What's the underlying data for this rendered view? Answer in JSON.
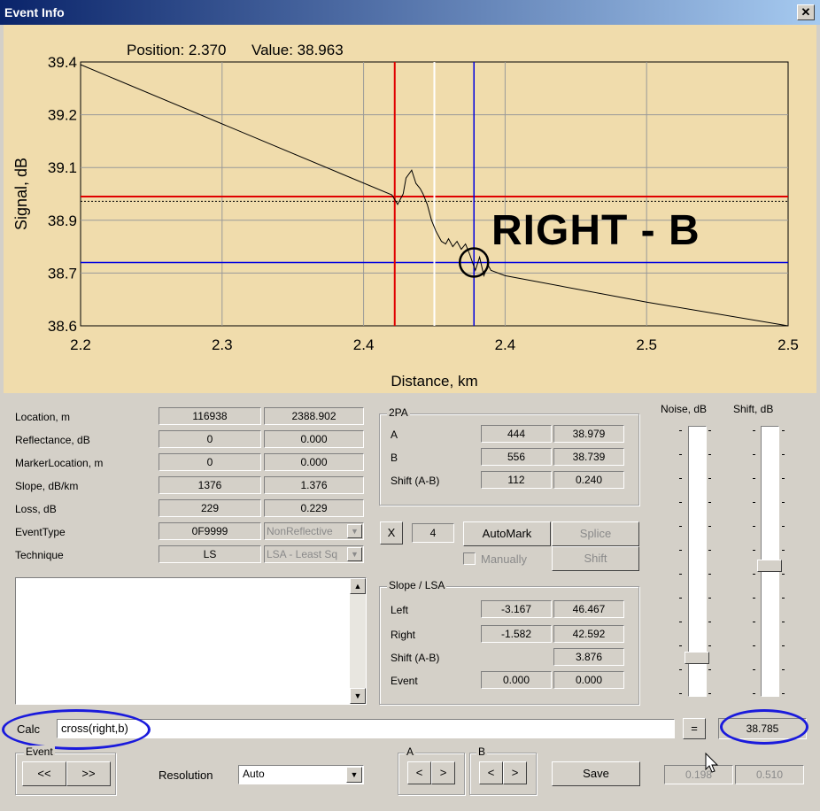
{
  "window": {
    "title": "Event Info",
    "close_glyph": "✕"
  },
  "plot": {
    "position_label": "Position: 2.370",
    "value_label": "Value: 38.963",
    "annotation": "RIGHT - B",
    "colors": {
      "red": "#e00000",
      "blue": "#0000e0",
      "white": "#ffffff",
      "trace": "#000000"
    }
  },
  "chart_data": {
    "type": "line",
    "xlabel": "Distance, km",
    "ylabel": "Signal, dB",
    "x_ticks": [
      "2.2",
      "2.3",
      "2.4",
      "2.4",
      "2.5",
      "2.5"
    ],
    "y_ticks": [
      "39.4",
      "39.2",
      "39.1",
      "38.9",
      "38.7",
      "38.6"
    ],
    "xlim": [
      0,
      5
    ],
    "ylim": [
      0,
      5
    ],
    "trace_x": [
      0,
      2.2,
      2.24,
      2.28,
      2.3,
      2.34,
      2.37,
      2.4,
      2.42,
      2.45,
      2.48,
      2.51,
      2.55,
      2.58,
      2.6,
      2.63,
      2.66,
      2.69,
      2.72,
      2.75,
      2.77,
      2.79,
      2.82,
      2.85,
      2.88,
      2.9,
      3.0,
      4.0,
      5.0
    ],
    "trace_y": [
      4.95,
      2.48,
      2.3,
      2.5,
      2.8,
      2.95,
      2.7,
      2.6,
      2.5,
      2.3,
      2.0,
      1.8,
      1.6,
      1.55,
      1.65,
      1.5,
      1.6,
      1.45,
      1.55,
      1.35,
      1.2,
      1.05,
      1.3,
      0.95,
      1.15,
      1.05,
      0.95,
      0.45,
      0.0
    ],
    "cursor_red_x": 2.22,
    "cursor_white_x": 2.5,
    "cursor_blue_x": 2.78,
    "hline_red_y": 2.45,
    "hline_dotted_y": 2.36,
    "hline_blue_y": 1.2,
    "circle_x": 2.78,
    "circle_y": 1.2
  },
  "fields": {
    "rows": [
      {
        "label": "Location, m",
        "v1": "116938",
        "v2": "2388.902"
      },
      {
        "label": "Reflectance, dB",
        "v1": "0",
        "v2": "0.000"
      },
      {
        "label": "MarkerLocation, m",
        "v1": "0",
        "v2": "0.000"
      },
      {
        "label": "Slope, dB/km",
        "v1": "1376",
        "v2": "1.376"
      },
      {
        "label": "Loss, dB",
        "v1": "229",
        "v2": "0.229"
      },
      {
        "label": "EventType",
        "v1": "0F9999",
        "v2": "NonReflective"
      },
      {
        "label": "Technique",
        "v1": "LS",
        "v2": "LSA - Least Sq"
      }
    ],
    "dropdown_glyph": "▼"
  },
  "twopa": {
    "title": "2PA",
    "rows": [
      {
        "label": "A",
        "v1": "444",
        "v2": "38.979"
      },
      {
        "label": "B",
        "v1": "556",
        "v2": "38.739"
      },
      {
        "label": "Shift (A-B)",
        "v1": "112",
        "v2": "0.240"
      }
    ]
  },
  "controls": {
    "x_label": "X",
    "x_value": "4",
    "automark": "AutoMark",
    "splice": "Splice",
    "manually": "Manually",
    "shift": "Shift"
  },
  "slope": {
    "title": "Slope / LSA",
    "left_label": "Left",
    "left_v1": "-3.167",
    "left_v2": "46.467",
    "right_label": "Right",
    "right_v1": "-1.582",
    "right_v2": "42.592",
    "shift_label": "Shift (A-B)",
    "shift_v2": "3.876",
    "event_label": "Event",
    "event_v1": "0.000",
    "event_v2": "0.000"
  },
  "sliders": {
    "noise_label": "Noise, dB",
    "shift_label": "Shift, dB",
    "noise_level": 0.9,
    "shift_level": 0.5
  },
  "scroll": {
    "up": "▲",
    "down": "▼"
  },
  "calc": {
    "label": "Calc",
    "value": "cross(right,b)",
    "equals": "=",
    "result": "38.785"
  },
  "bottom": {
    "event_title": "Event",
    "prev": "<<",
    "next": ">>",
    "resolution_label": "Resolution",
    "resolution_value": "Auto",
    "a_title": "A",
    "b_title": "B",
    "left_arrow": "<",
    "right_arrow": ">",
    "save": "Save",
    "out1": "0.198",
    "out2": "0.510"
  }
}
